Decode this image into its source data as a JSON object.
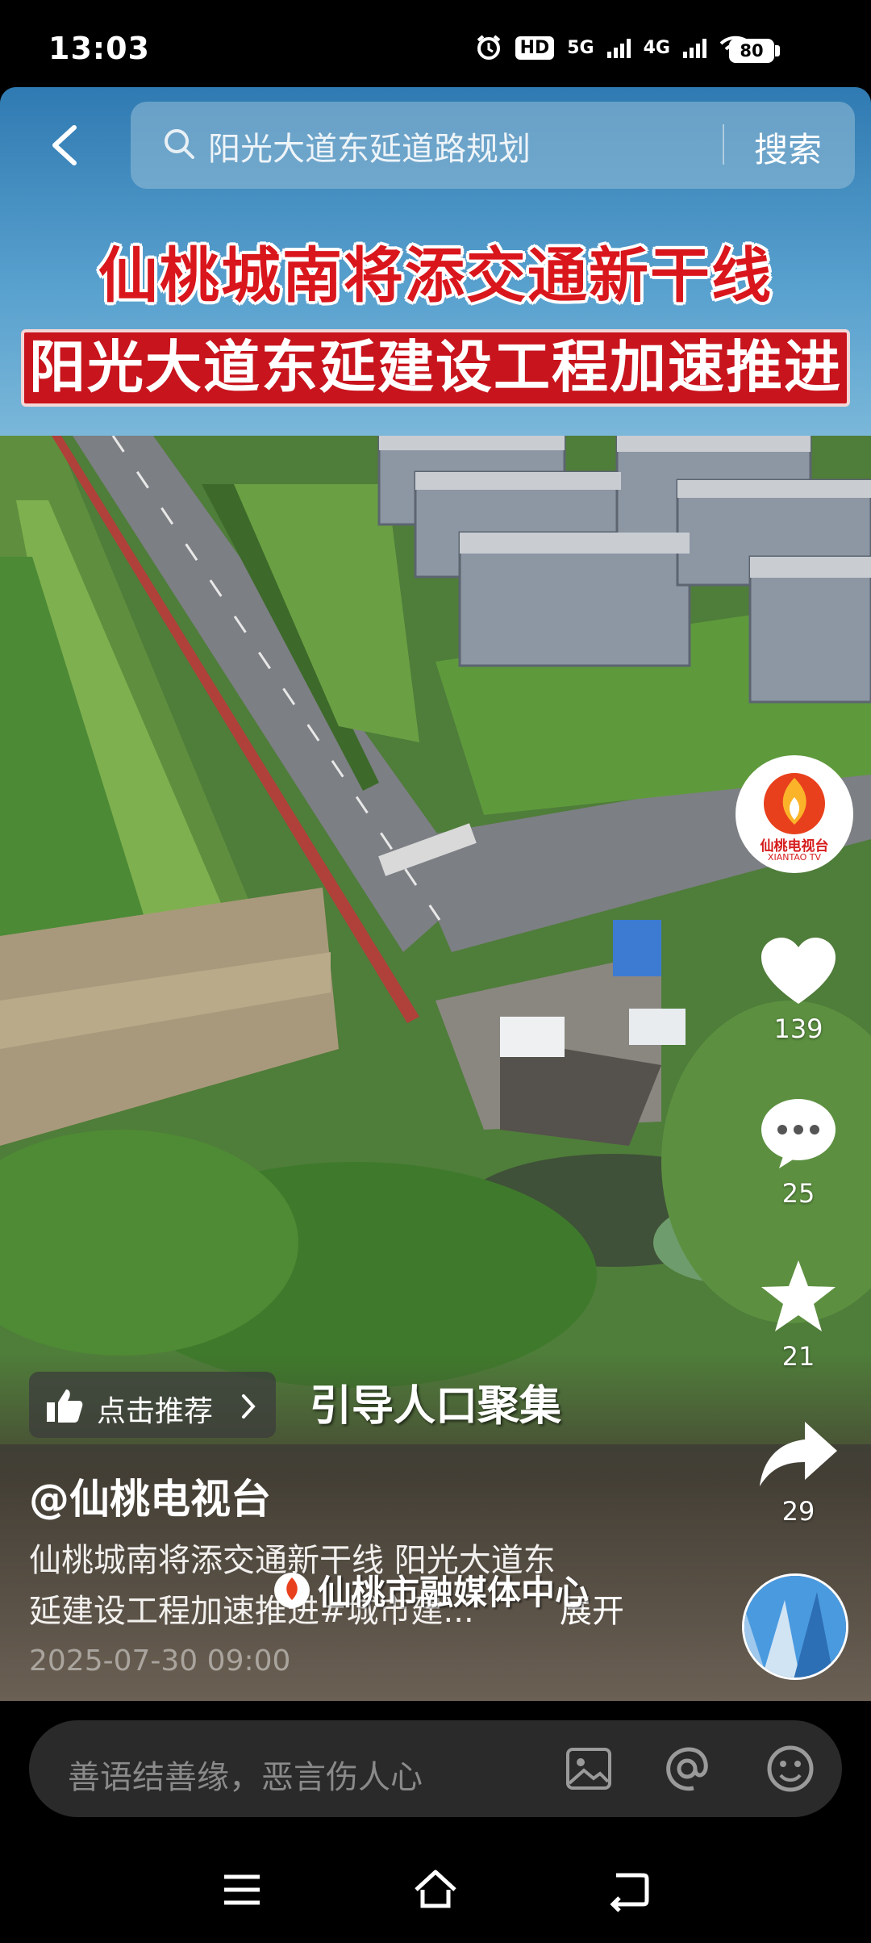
{
  "status_bar": {
    "time": "13:03",
    "hd_badge": "HD",
    "net_1": "5G",
    "net_2": "4G",
    "battery": "80"
  },
  "search": {
    "query": "阳光大道东延道路规划",
    "button_label": "搜索"
  },
  "video": {
    "headline_line1": "仙桃城南将添交通新干线",
    "headline_line2": "阳光大道东延建设工程加速推进",
    "subtitle": "引导人口聚集",
    "watermark": "仙桃市融媒体中心",
    "channel_logo_text": "仙桃电视台",
    "channel_logo_sub": "XIANTAO TV"
  },
  "actions": {
    "like_count": "139",
    "comment_count": "25",
    "favorite_count": "21",
    "share_count": "29"
  },
  "post": {
    "recommend_label": "点击推荐",
    "author": "@仙桃电视台",
    "description_line1": "仙桃城南将添交通新干线 阳光大道东",
    "description_line2": "延建设工程加速推进#城市建...",
    "expand_label": "展开",
    "date": "2025-07-30 09:00"
  },
  "comment_bar": {
    "placeholder": "善语结善缘，恶言伤人心"
  },
  "colors": {
    "headline_red": "#d9161c",
    "banner_red": "#c8141d",
    "sky_blue": "#2f7ab2"
  }
}
